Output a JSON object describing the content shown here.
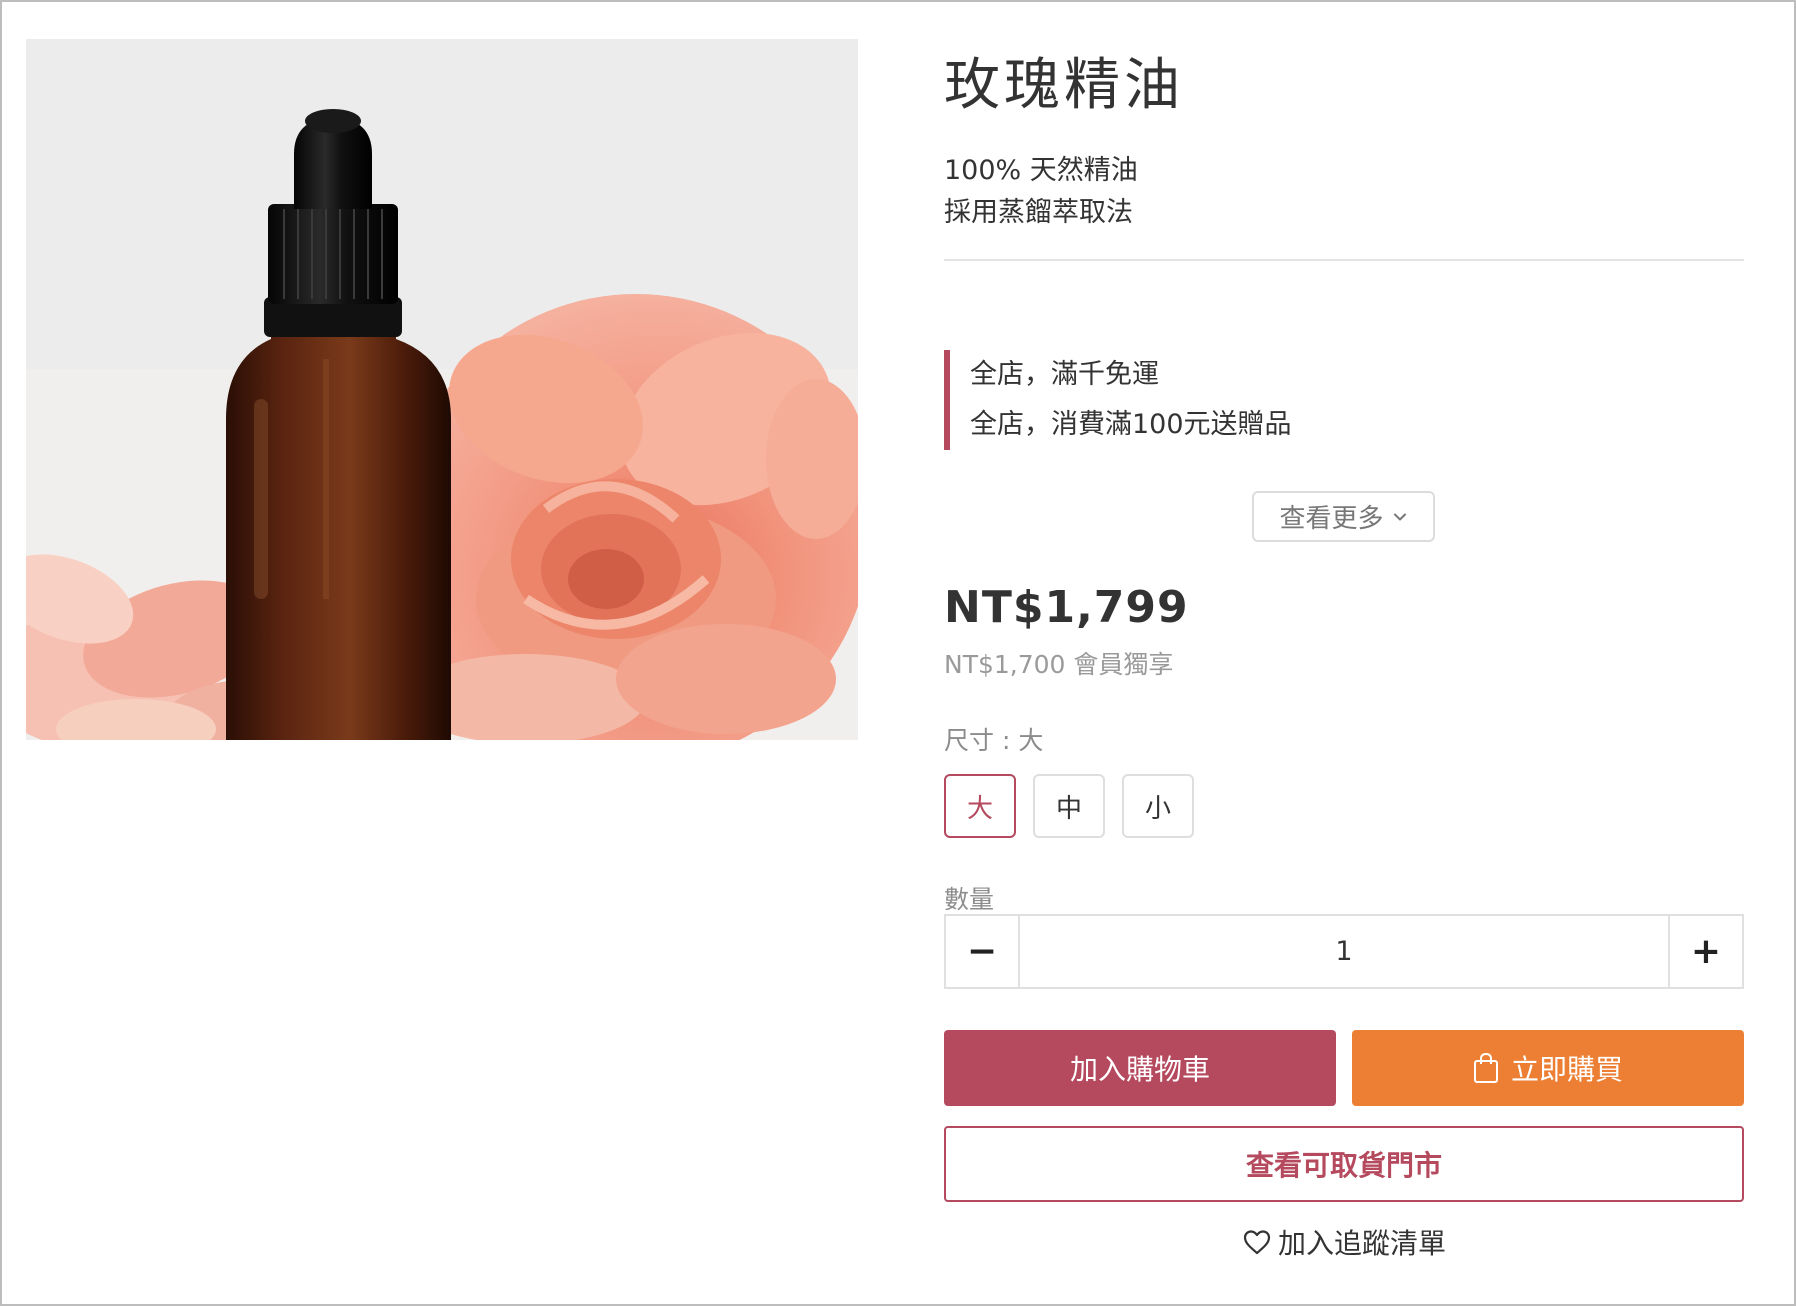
{
  "product": {
    "title": "玫瑰精油",
    "description": [
      "100% 天然精油",
      "採用蒸餾萃取法"
    ]
  },
  "promotions": {
    "items": [
      "全店，滿千免運",
      "全店，消費滿100元送贈品"
    ],
    "more_label": "查看更多"
  },
  "pricing": {
    "price": "NT$1,799",
    "member_price": "NT$1,700 會員獨享"
  },
  "size": {
    "label": "尺寸 : 大",
    "options": [
      "大",
      "中",
      "小"
    ],
    "selected": "大"
  },
  "quantity": {
    "label": "數量",
    "value": "1",
    "minus_symbol": "−",
    "plus_symbol": "+"
  },
  "actions": {
    "add_to_cart": "加入購物車",
    "buy_now": "立即購買",
    "pickup_stores": "查看可取貨門市",
    "wishlist": "加入追蹤清單"
  },
  "icons": {
    "more": "chevron-down-icon",
    "buy_now": "shopping-bag-icon",
    "wishlist": "heart-icon"
  },
  "colors": {
    "accent": "#b5495e",
    "buy_now": "#ec7f33",
    "price": "#333333",
    "muted": "#9a9a9a"
  }
}
